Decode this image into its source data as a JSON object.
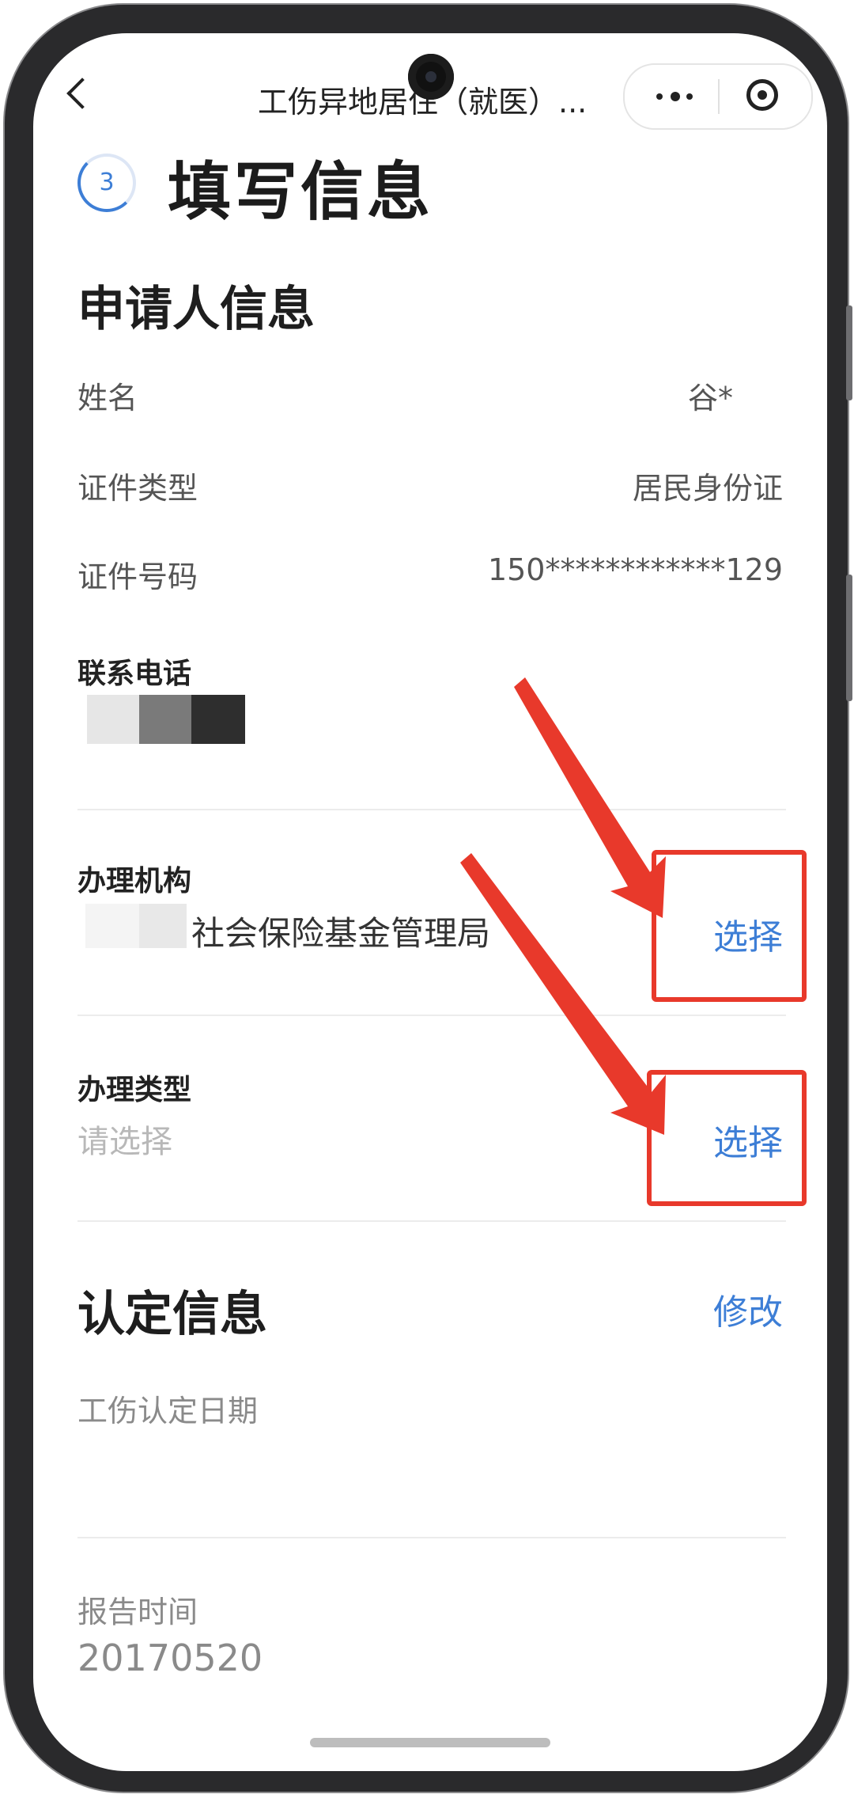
{
  "header": {
    "title": "工伤异地居住（就医）..."
  },
  "step": {
    "number": "3",
    "title": "填写信息"
  },
  "applicant": {
    "section_title": "申请人信息",
    "name_label": "姓名",
    "name_value": "谷*",
    "id_type_label": "证件类型",
    "id_type_value": "居民身份证",
    "id_number_label": "证件号码",
    "id_number_value": "150************129",
    "phone_label": "联系电话"
  },
  "agency": {
    "label": "办理机构",
    "value": "社会保险基金管理局",
    "action": "选择"
  },
  "handle_type": {
    "label": "办理类型",
    "placeholder": "请选择",
    "action": "选择"
  },
  "certification": {
    "section_title": "认定信息",
    "action": "修改",
    "date_label": "工伤认定日期",
    "report_label": "报告时间",
    "report_value": "20170520"
  },
  "colors": {
    "accent": "#3d7ed6",
    "annotation": "#e8392b"
  }
}
